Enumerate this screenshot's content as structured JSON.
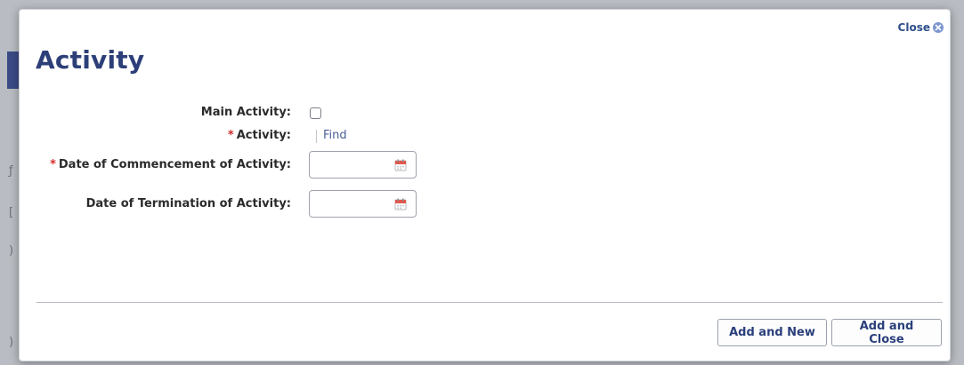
{
  "dialog": {
    "title": "Activity",
    "close_label": "Close"
  },
  "form": {
    "main_activity": {
      "label": "Main Activity:",
      "checked": false
    },
    "activity": {
      "required_mark": "*",
      "label": "Activity:",
      "find_label": "Find"
    },
    "date_commencement": {
      "required_mark": "*",
      "label": "Date of Commencement of Activity:",
      "value": ""
    },
    "date_termination": {
      "label": "Date of Termination of Activity:",
      "value": ""
    }
  },
  "footer": {
    "add_and_new_label": "Add and New",
    "add_and_close_label": "Add and Close"
  },
  "colors": {
    "accent": "#2c3f78",
    "required": "#d42b2b",
    "link": "#4a5f96"
  }
}
